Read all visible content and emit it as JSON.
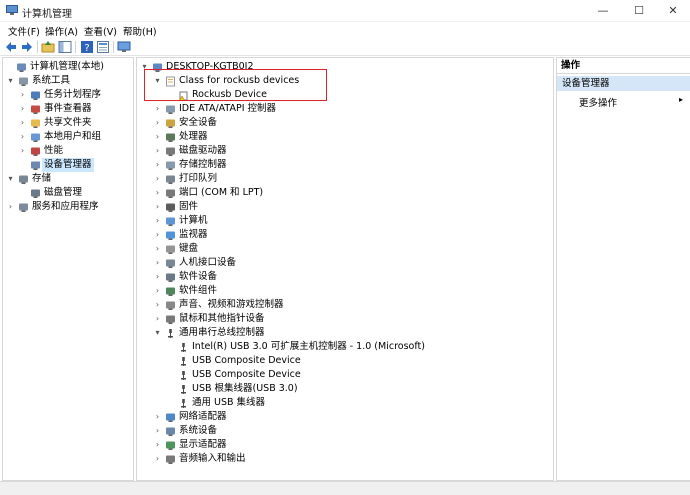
{
  "window": {
    "title": "计算机管理"
  },
  "menu": [
    "文件(F)",
    "操作(A)",
    "查看(V)",
    "帮助(H)"
  ],
  "left_tree": [
    {
      "label": "计算机管理(本地)",
      "expander": "",
      "icon": "computer-management-icon",
      "icon_color": "#5b7fb3"
    },
    {
      "label": "系统工具",
      "expander": "▾",
      "icon": "tools-icon",
      "icon_color": "#7b8a9a"
    },
    {
      "label": "任务计划程序",
      "expander": "›",
      "icon": "clock-icon",
      "icon_color": "#3a6fb0"
    },
    {
      "label": "事件查看器",
      "expander": "›",
      "icon": "event-viewer-icon",
      "icon_color": "#c0392b"
    },
    {
      "label": "共享文件夹",
      "expander": "›",
      "icon": "shared-folder-icon",
      "icon_color": "#e2b33c"
    },
    {
      "label": "本地用户和组",
      "expander": "›",
      "icon": "users-icon",
      "icon_color": "#5a8ccf"
    },
    {
      "label": "性能",
      "expander": "›",
      "icon": "performance-icon",
      "icon_color": "#b83030"
    },
    {
      "label": "设备管理器",
      "expander": "",
      "icon": "device-manager-icon",
      "icon_color": "#5d7ea8",
      "selected": true
    },
    {
      "label": "存储",
      "expander": "▾",
      "icon": "storage-icon",
      "icon_color": "#6b7a8a"
    },
    {
      "label": "磁盘管理",
      "expander": "",
      "icon": "disk-icon",
      "icon_color": "#5b6b7b"
    },
    {
      "label": "服务和应用程序",
      "expander": "›",
      "icon": "services-icon",
      "icon_color": "#6e7f93"
    }
  ],
  "device_tree": [
    {
      "label": "DESKTOP-KGTB0I2",
      "expander": "▾",
      "icon": "computer-icon",
      "icon_color": "#4d7bbd"
    },
    {
      "label": "Class for rockusb devices",
      "expander": "▾",
      "icon": "device-class-icon",
      "icon_color": "#e0b060"
    },
    {
      "label": "Rockusb Device",
      "expander": "",
      "icon": "warning-device-icon",
      "icon_color": "#7a7a7a"
    },
    {
      "label": "IDE ATA/ATAPI 控制器",
      "expander": "›",
      "icon": "ide-controller-icon",
      "icon_color": "#7b8ea3"
    },
    {
      "label": "安全设备",
      "expander": "›",
      "icon": "security-device-icon",
      "icon_color": "#c79a2a"
    },
    {
      "label": "处理器",
      "expander": "›",
      "icon": "processor-icon",
      "icon_color": "#4a6a4a"
    },
    {
      "label": "磁盘驱动器",
      "expander": "›",
      "icon": "disk-drive-icon",
      "icon_color": "#6a6a6a"
    },
    {
      "label": "存储控制器",
      "expander": "›",
      "icon": "storage-controller-icon",
      "icon_color": "#7b8ea3"
    },
    {
      "label": "打印队列",
      "expander": "›",
      "icon": "printer-icon",
      "icon_color": "#6a7a8a"
    },
    {
      "label": "端口 (COM 和 LPT)",
      "expander": "›",
      "icon": "port-icon",
      "icon_color": "#6a6a6a"
    },
    {
      "label": "固件",
      "expander": "›",
      "icon": "firmware-icon",
      "icon_color": "#4a4a4a"
    },
    {
      "label": "计算机",
      "expander": "›",
      "icon": "computer-icon",
      "icon_color": "#4d8bd0"
    },
    {
      "label": "监视器",
      "expander": "›",
      "icon": "monitor-icon",
      "icon_color": "#3d8ad8"
    },
    {
      "label": "键盘",
      "expander": "›",
      "icon": "keyboard-icon",
      "icon_color": "#8a8a8a"
    },
    {
      "label": "人机接口设备",
      "expander": "›",
      "icon": "hid-icon",
      "icon_color": "#6a7a8a"
    },
    {
      "label": "软件设备",
      "expander": "›",
      "icon": "software-device-icon",
      "icon_color": "#5a6a7a"
    },
    {
      "label": "软件组件",
      "expander": "›",
      "icon": "software-component-icon",
      "icon_color": "#3a7a4a"
    },
    {
      "label": "声音、视频和游戏控制器",
      "expander": "›",
      "icon": "sound-icon",
      "icon_color": "#7a7a7a"
    },
    {
      "label": "鼠标和其他指针设备",
      "expander": "›",
      "icon": "mouse-icon",
      "icon_color": "#6a6a6a"
    },
    {
      "label": "通用串行总线控制器",
      "expander": "▾",
      "icon": "usb-icon",
      "icon_color": "#4a4a4a"
    },
    {
      "label": "Intel(R) USB 3.0 可扩展主机控制器 - 1.0 (Microsoft)",
      "expander": "",
      "icon": "usb-icon",
      "icon_color": "#4a4a4a"
    },
    {
      "label": "USB Composite Device",
      "expander": "",
      "icon": "usb-icon",
      "icon_color": "#4a4a4a"
    },
    {
      "label": "USB Composite Device",
      "expander": "",
      "icon": "usb-icon",
      "icon_color": "#4a4a4a"
    },
    {
      "label": "USB 根集线器(USB 3.0)",
      "expander": "",
      "icon": "usb-icon",
      "icon_color": "#4a4a4a"
    },
    {
      "label": "通用 USB 集线器",
      "expander": "",
      "icon": "usb-icon",
      "icon_color": "#4a4a4a"
    },
    {
      "label": "网络适配器",
      "expander": "›",
      "icon": "network-adapter-icon",
      "icon_color": "#3d7ac0"
    },
    {
      "label": "系统设备",
      "expander": "›",
      "icon": "system-device-icon",
      "icon_color": "#5a7aa0"
    },
    {
      "label": "显示适配器",
      "expander": "›",
      "icon": "display-adapter-icon",
      "icon_color": "#3a8a4a"
    },
    {
      "label": "音频输入和输出",
      "expander": "›",
      "icon": "audio-icon",
      "icon_color": "#6a6a6a"
    }
  ],
  "actions": {
    "header": "操作",
    "section": "设备管理器",
    "more": "更多操作",
    "more_arrow": "▸"
  },
  "colors": {
    "selection": "#cce8ff",
    "highlight_border": "#e0202a",
    "actions_section_bg": "#d4e6f7"
  }
}
